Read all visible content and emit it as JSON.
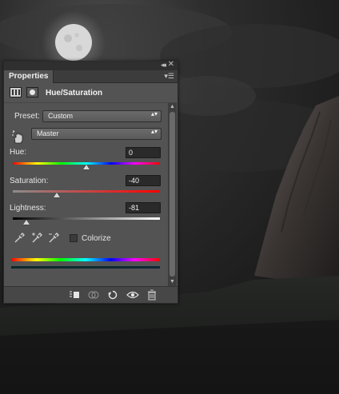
{
  "panel": {
    "tab_label": "Properties",
    "collapse_glyph": "◂◂",
    "close_glyph": "✕",
    "menu_glyph": "▾☰",
    "adjustment_title": "Hue/Saturation",
    "preset_label": "Preset:",
    "preset_value": "Custom",
    "channel_value": "Master",
    "select_arrows": "▴▾",
    "colorize_label": "Colorize"
  },
  "sliders": {
    "hue": {
      "label": "Hue:",
      "value": "0",
      "position": 0.5
    },
    "saturation": {
      "label": "Saturation:",
      "value": "-40",
      "position": 0.3
    },
    "lightness": {
      "label": "Lightness:",
      "value": "-81",
      "position": 0.095
    }
  },
  "icons": [
    "collapse-icon",
    "close-icon",
    "panel-menu-icon",
    "adjustment-layer-icon",
    "layer-mask-icon",
    "targeted-adjustment-hand-icon",
    "eyedropper-icon",
    "eyedropper-plus-icon",
    "eyedropper-minus-icon",
    "clip-to-layer-icon",
    "view-previous-state-icon",
    "reset-icon",
    "visibility-eye-icon",
    "trash-icon"
  ],
  "colors": {
    "panel_bg": "#535353",
    "field_bg": "#2a2a2a",
    "saturation_end": "#ff0000"
  }
}
